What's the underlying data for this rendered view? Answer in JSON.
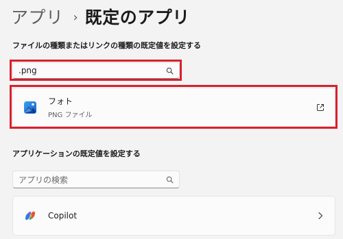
{
  "breadcrumb": {
    "parent": "アプリ",
    "separator": "›",
    "current": "既定のアプリ"
  },
  "filetype_section": {
    "label": "ファイルの種類またはリンクの種類の既定値を設定する",
    "search_value": ".png",
    "result": {
      "app_name": "フォト",
      "description": "PNG ファイル",
      "icon": "photos-app-icon",
      "trailing_icon": "open-external-icon"
    }
  },
  "apps_section": {
    "label": "アプリケーションの既定値を設定する",
    "search_placeholder": "アプリの検索",
    "items": [
      {
        "app_name": "Copilot",
        "icon": "copilot-app-icon",
        "trailing_icon": "chevron-right-icon"
      }
    ]
  },
  "colors": {
    "highlight": "#d9202d",
    "background": "#f3f3f3",
    "card": "#fbfbfb"
  }
}
